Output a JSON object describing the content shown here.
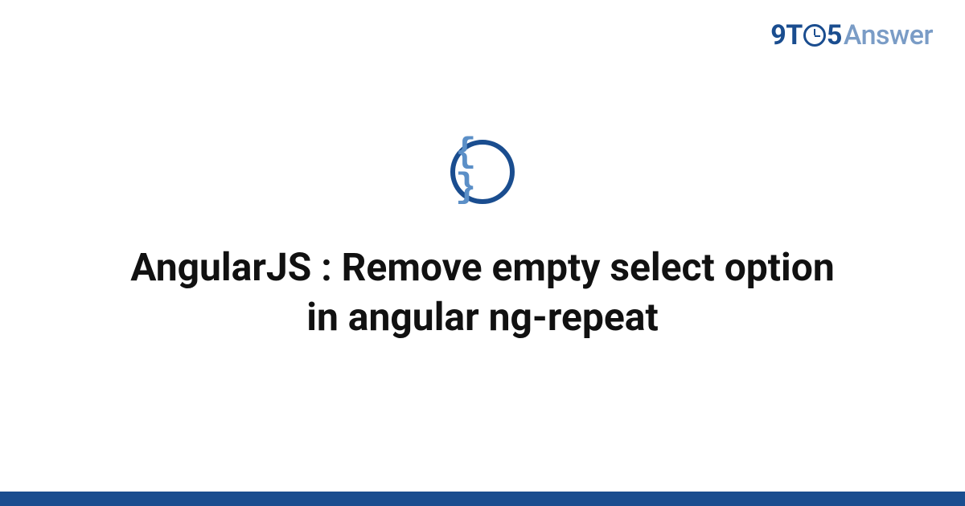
{
  "brand": {
    "part1": "9",
    "part2": "T",
    "part3": "5",
    "part4": "Answer"
  },
  "category": {
    "icon_name": "code-braces",
    "glyph": "{ }"
  },
  "title": "AngularJS : Remove empty select option in angular ng-repeat",
  "colors": {
    "brand_primary": "#1a4d8f",
    "brand_secondary": "#7a9cc6",
    "icon_fill": "#5b8fc7"
  }
}
